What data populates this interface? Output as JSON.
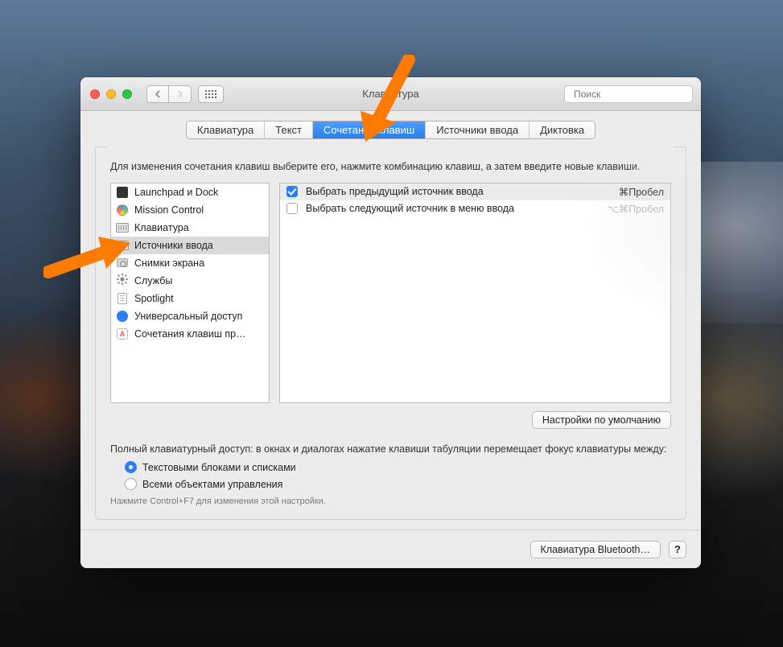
{
  "window": {
    "title": "Клавиатура"
  },
  "search": {
    "placeholder": "Поиск"
  },
  "tabs": [
    {
      "label": "Клавиатура",
      "active": false
    },
    {
      "label": "Текст",
      "active": false
    },
    {
      "label": "Сочетания клавиш",
      "active": true
    },
    {
      "label": "Источники ввода",
      "active": false
    },
    {
      "label": "Диктовка",
      "active": false
    }
  ],
  "caption": "Для изменения сочетания клавиш выберите его, нажмите комбинацию клавиш, а затем введите новые клавиши.",
  "categories": [
    {
      "label": "Launchpad и Dock",
      "icon": "block",
      "selected": false
    },
    {
      "label": "Mission Control",
      "icon": "circ",
      "selected": false
    },
    {
      "label": "Клавиатура",
      "icon": "keyboard",
      "selected": false
    },
    {
      "label": "Источники ввода",
      "icon": "keyboard",
      "selected": true
    },
    {
      "label": "Снимки экрана",
      "icon": "cam",
      "selected": false
    },
    {
      "label": "Службы",
      "icon": "gear",
      "selected": false
    },
    {
      "label": "Spotlight",
      "icon": "txt",
      "selected": false
    },
    {
      "label": "Универсальный доступ",
      "icon": "ua",
      "selected": false
    },
    {
      "label": "Сочетания клавиш пр…",
      "icon": "app",
      "selected": false
    }
  ],
  "shortcuts": [
    {
      "label": "Выбрать предыдущий источник ввода",
      "combo": "⌘Пробел",
      "checked": true,
      "dim": false
    },
    {
      "label": "Выбрать следующий источник в меню ввода",
      "combo": "⌥⌘Пробел",
      "checked": false,
      "dim": true
    }
  ],
  "defaults_btn": "Настройки по умолчанию",
  "fka": {
    "text": "Полный клавиатурный доступ: в окнах и диалогах нажатие клавиши табуляции перемещает фокус клавиатуры между:",
    "options": [
      {
        "label": "Текстовыми блоками и списками",
        "selected": true
      },
      {
        "label": "Всеми объектами управления",
        "selected": false
      }
    ],
    "hint": "Нажмите Control+F7 для изменения этой настройки."
  },
  "footer": {
    "bluetooth": "Клавиатура Bluetooth…",
    "help": "?"
  }
}
